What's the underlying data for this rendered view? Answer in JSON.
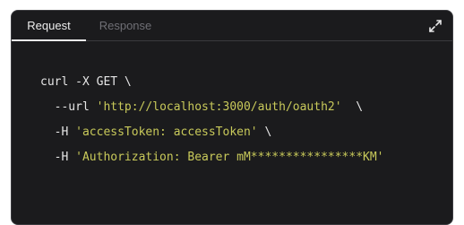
{
  "tabs": {
    "request": "Request",
    "response": "Response"
  },
  "expand_icon": "expand-arrows-icon",
  "code": {
    "line1": "curl -X GET \\",
    "line2_flag": "  --url ",
    "line2_value": "'http://localhost:3000/auth/oauth2'",
    "line2_tail": "  \\",
    "line3_flag": "  -H ",
    "line3_value": "'accessToken: accessToken'",
    "line3_tail": " \\",
    "line4_flag": "  -H ",
    "line4_value": "'Authorization: Bearer mM****************KM'"
  },
  "colors": {
    "background": "#1b1b1d",
    "string": "#c8c95a",
    "text": "#e6e6e6",
    "tab_inactive": "#6f6f75"
  }
}
